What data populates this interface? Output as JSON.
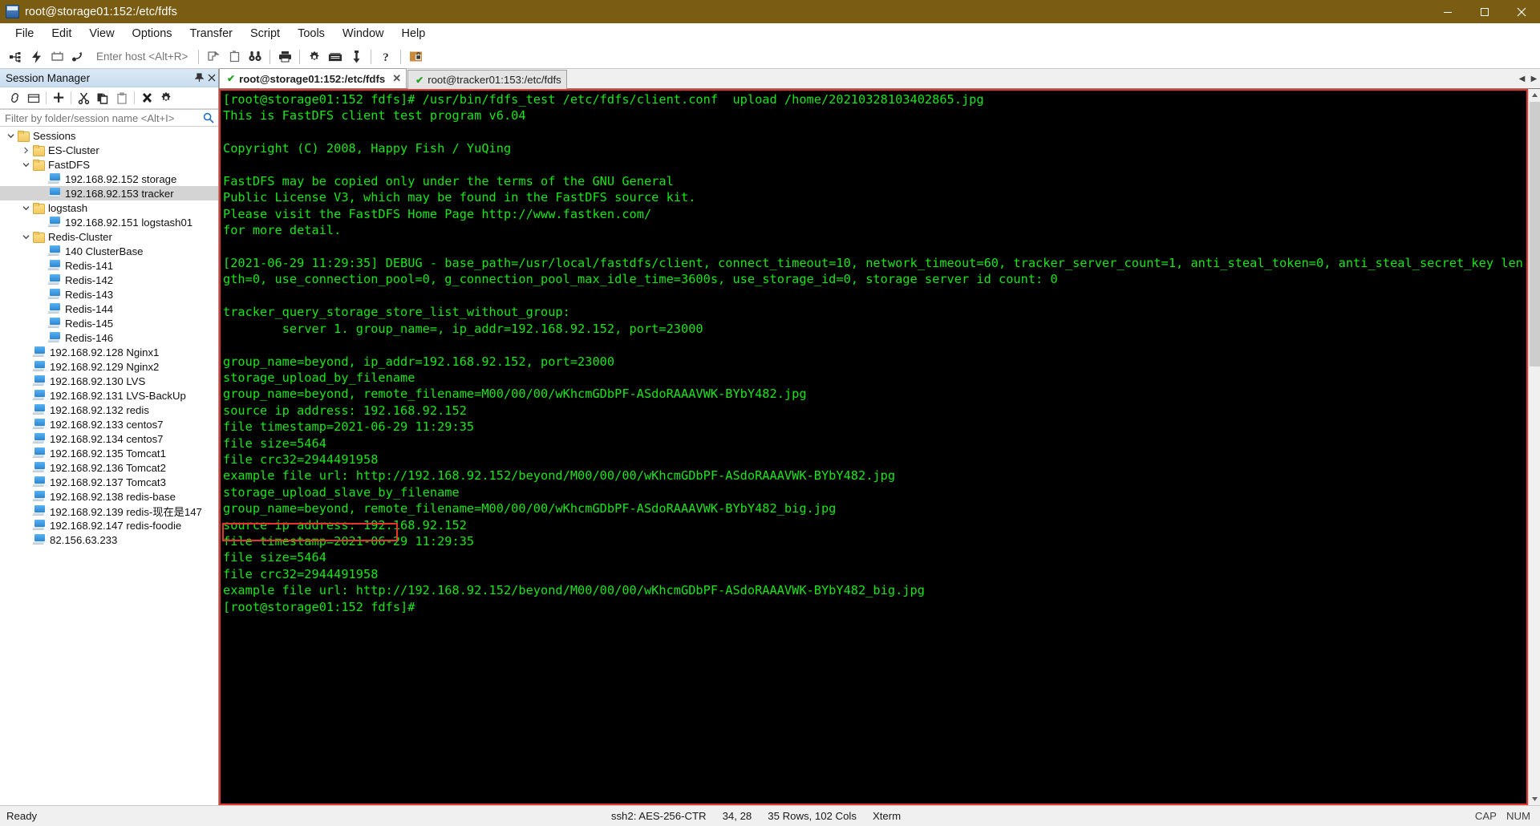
{
  "window": {
    "title": "root@storage01:152:/etc/fdfs",
    "app_icon": "terminal-app-icon",
    "minimize": "minimize-icon",
    "maximize": "maximize-icon",
    "close": "close-icon"
  },
  "menubar": {
    "items": [
      {
        "label": "File"
      },
      {
        "label": "Edit"
      },
      {
        "label": "View"
      },
      {
        "label": "Options"
      },
      {
        "label": "Transfer"
      },
      {
        "label": "Script"
      },
      {
        "label": "Tools"
      },
      {
        "label": "Window"
      },
      {
        "label": "Help"
      }
    ]
  },
  "toolbar": {
    "host_placeholder": "Enter host <Alt+R>",
    "icons": [
      "connect-icon",
      "quick-connect-icon",
      "connect-in-tab-icon",
      "connect-sftp-icon",
      "clone-session-icon",
      "new-tab-icon",
      "find-icon",
      "print-icon",
      "session-options-icon",
      "keymap-editor-icon",
      "transfer-receive-icon",
      "help-icon",
      "secure-lock-icon"
    ]
  },
  "session_manager": {
    "title": "Session Manager",
    "pin_icon": "pin-icon",
    "close_icon": "close-icon",
    "toolbar_icons": [
      "connect-session-icon",
      "new-folder-icon",
      "new-session-icon",
      "cut-icon",
      "copy-icon",
      "paste-icon",
      "delete-icon",
      "properties-icon"
    ],
    "filter_placeholder": "Filter by folder/session name <Alt+I>",
    "filter_value": "",
    "search_icon": "search-icon",
    "tree": [
      {
        "label": "Sessions",
        "type": "folder",
        "depth": 0,
        "expander": "down",
        "selected": false
      },
      {
        "label": "ES-Cluster",
        "type": "folder",
        "depth": 1,
        "expander": "right",
        "selected": false
      },
      {
        "label": "FastDFS",
        "type": "folder",
        "depth": 1,
        "expander": "down",
        "selected": false
      },
      {
        "label": "192.168.92.152 storage",
        "type": "session",
        "depth": 2,
        "expander": "none",
        "selected": false
      },
      {
        "label": "192.168.92.153 tracker",
        "type": "session",
        "depth": 2,
        "expander": "none",
        "selected": true
      },
      {
        "label": "logstash",
        "type": "folder",
        "depth": 1,
        "expander": "down",
        "selected": false
      },
      {
        "label": "192.168.92.151 logstash01",
        "type": "session",
        "depth": 2,
        "expander": "none",
        "selected": false
      },
      {
        "label": "Redis-Cluster",
        "type": "folder",
        "depth": 1,
        "expander": "down",
        "selected": false
      },
      {
        "label": "140 ClusterBase",
        "type": "session",
        "depth": 2,
        "expander": "none",
        "selected": false
      },
      {
        "label": "Redis-141",
        "type": "session",
        "depth": 2,
        "expander": "none",
        "selected": false
      },
      {
        "label": "Redis-142",
        "type": "session",
        "depth": 2,
        "expander": "none",
        "selected": false
      },
      {
        "label": "Redis-143",
        "type": "session",
        "depth": 2,
        "expander": "none",
        "selected": false
      },
      {
        "label": "Redis-144",
        "type": "session",
        "depth": 2,
        "expander": "none",
        "selected": false
      },
      {
        "label": "Redis-145",
        "type": "session",
        "depth": 2,
        "expander": "none",
        "selected": false
      },
      {
        "label": "Redis-146",
        "type": "session",
        "depth": 2,
        "expander": "none",
        "selected": false
      },
      {
        "label": "192.168.92.128 Nginx1",
        "type": "session",
        "depth": 1,
        "expander": "none",
        "selected": false
      },
      {
        "label": "192.168.92.129 Nginx2",
        "type": "session",
        "depth": 1,
        "expander": "none",
        "selected": false
      },
      {
        "label": "192.168.92.130 LVS",
        "type": "session",
        "depth": 1,
        "expander": "none",
        "selected": false
      },
      {
        "label": "192.168.92.131 LVS-BackUp",
        "type": "session",
        "depth": 1,
        "expander": "none",
        "selected": false
      },
      {
        "label": "192.168.92.132 redis",
        "type": "session",
        "depth": 1,
        "expander": "none",
        "selected": false
      },
      {
        "label": "192.168.92.133 centos7",
        "type": "session",
        "depth": 1,
        "expander": "none",
        "selected": false
      },
      {
        "label": "192.168.92.134 centos7",
        "type": "session",
        "depth": 1,
        "expander": "none",
        "selected": false
      },
      {
        "label": "192.168.92.135 Tomcat1",
        "type": "session",
        "depth": 1,
        "expander": "none",
        "selected": false
      },
      {
        "label": "192.168.92.136 Tomcat2",
        "type": "session",
        "depth": 1,
        "expander": "none",
        "selected": false
      },
      {
        "label": "192.168.92.137 Tomcat3",
        "type": "session",
        "depth": 1,
        "expander": "none",
        "selected": false
      },
      {
        "label": "192.168.92.138 redis-base",
        "type": "session",
        "depth": 1,
        "expander": "none",
        "selected": false
      },
      {
        "label": "192.168.92.139 redis-现在是147",
        "type": "session",
        "depth": 1,
        "expander": "none",
        "selected": false
      },
      {
        "label": "192.168.92.147 redis-foodie",
        "type": "session",
        "depth": 1,
        "expander": "none",
        "selected": false
      },
      {
        "label": "82.156.63.233",
        "type": "session",
        "depth": 1,
        "expander": "none",
        "selected": false
      }
    ]
  },
  "tabs": {
    "items": [
      {
        "label": "root@storage01:152:/etc/fdfs",
        "active": true,
        "status_icon": "connected-check-icon",
        "close_icon": "close-icon"
      },
      {
        "label": "root@tracker01:153:/etc/fdfs",
        "active": false,
        "status_icon": "connected-check-icon",
        "close_icon": ""
      }
    ],
    "nav_left": "chevron-left-icon",
    "nav_right": "chevron-right-icon"
  },
  "terminal": {
    "text": "[root@storage01:152 fdfs]# /usr/bin/fdfs_test /etc/fdfs/client.conf  upload /home/20210328103402865.jpg\nThis is FastDFS client test program v6.04\n\nCopyright (C) 2008, Happy Fish / YuQing\n\nFastDFS may be copied only under the terms of the GNU General\nPublic License V3, which may be found in the FastDFS source kit.\nPlease visit the FastDFS Home Page http://www.fastken.com/\nfor more detail.\n\n[2021-06-29 11:29:35] DEBUG - base_path=/usr/local/fastdfs/client, connect_timeout=10, network_timeout=60, tracker_server_count=1, anti_steal_token=0, anti_steal_secret_key length=0, use_connection_pool=0, g_connection_pool_max_idle_time=3600s, use_storage_id=0, storage server id count: 0\n\ntracker_query_storage_store_list_without_group:\n        server 1. group_name=, ip_addr=192.168.92.152, port=23000\n\ngroup_name=beyond, ip_addr=192.168.92.152, port=23000\nstorage_upload_by_filename\ngroup_name=beyond, remote_filename=M00/00/00/wKhcmGDbPF-ASdoRAAAVWK-BYbY482.jpg\nsource ip address: 192.168.92.152\nfile timestamp=2021-06-29 11:29:35\nfile size=5464\nfile crc32=2944491958\nexample file url: http://192.168.92.152/beyond/M00/00/00/wKhcmGDbPF-ASdoRAAAVWK-BYbY482.jpg\nstorage_upload_slave_by_filename\ngroup_name=beyond, remote_filename=M00/00/00/wKhcmGDbPF-ASdoRAAAVWK-BYbY482_big.jpg\nsource ip address: 192.168.92.152\nfile timestamp=2021-06-29 11:29:35\nfile size=5464\nfile crc32=2944491958\nexample file url: http://192.168.92.152/beyond/M00/00/00/wKhcmGDbPF-ASdoRAAAVWK-BYbY482_big.jpg\n[root@storage01:152 fdfs]#",
    "fg_color": "#19e619",
    "bg_color": "#000000",
    "annotation_color": "#e8352a"
  },
  "statusbar": {
    "ready": "Ready",
    "cipher": "ssh2: AES-256-CTR",
    "cursor": "34, 28",
    "size": "35 Rows, 102 Cols",
    "emulation": "Xterm",
    "caps": "CAP",
    "num": "NUM"
  }
}
